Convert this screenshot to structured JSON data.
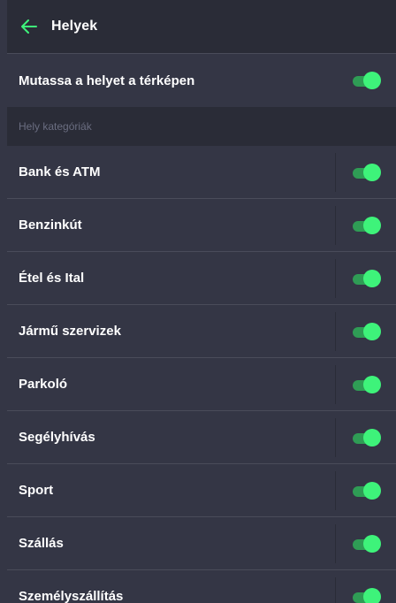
{
  "header": {
    "title": "Helyek",
    "back_icon": "arrow-left-icon",
    "accent_color": "#3ef37a"
  },
  "main_setting": {
    "label": "Mutassa a helyet a térképen",
    "enabled": true
  },
  "section": {
    "label": "Hely kategóriák"
  },
  "categories": [
    {
      "label": "Bank és ATM",
      "enabled": true
    },
    {
      "label": "Benzinkút",
      "enabled": true
    },
    {
      "label": "Étel és Ital",
      "enabled": true
    },
    {
      "label": "Jármű szervizek",
      "enabled": true
    },
    {
      "label": "Parkoló",
      "enabled": true
    },
    {
      "label": "Segélyhívás",
      "enabled": true
    },
    {
      "label": "Sport",
      "enabled": true
    },
    {
      "label": "Szállás",
      "enabled": true
    },
    {
      "label": "Személyszállítás",
      "enabled": true
    }
  ]
}
